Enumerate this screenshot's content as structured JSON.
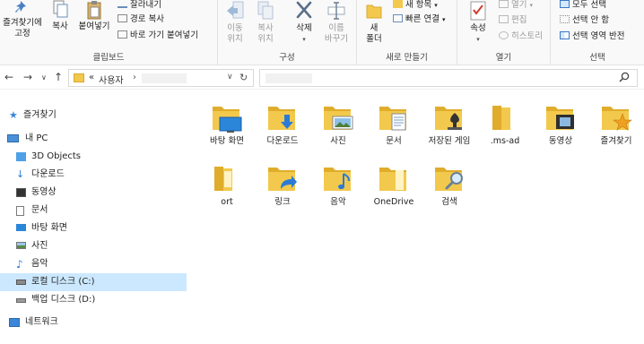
{
  "ribbon": {
    "clipboard": {
      "group_label": "클립보드",
      "pin_label_1": "즐겨찾기에",
      "pin_label_2": "고정",
      "copy_label": "복사",
      "paste_label": "붙여넣기",
      "cut_label": "잘라내기",
      "copy_path_label": "경로 복사",
      "paste_shortcut_label": "바로 가기 붙여넣기"
    },
    "organize": {
      "group_label": "구성",
      "move_label_1": "이동",
      "move_label_2": "위치",
      "copyto_label_1": "복사",
      "copyto_label_2": "위치",
      "delete_label": "삭제",
      "rename_label_1": "이름",
      "rename_label_2": "바꾸기"
    },
    "new": {
      "group_label": "새로 만들기",
      "new_folder_label_1": "새",
      "new_folder_label_2": "폴더",
      "new_item_label": "새 항목",
      "easy_access_label": "빠른 연결"
    },
    "open": {
      "group_label": "열기",
      "properties_label": "속성",
      "open_label": "열기",
      "edit_label": "편집",
      "history_label": "히스토리"
    },
    "select": {
      "group_label": "선택",
      "select_all_label": "모두 선택",
      "select_none_label": "선택 안 함",
      "invert_label": "선택 영역 반전"
    }
  },
  "address": {
    "prefix": "«",
    "segment": "사용자",
    "separator": "›"
  },
  "nav": {
    "quick_access": "즐겨찾기",
    "this_pc": "내 PC",
    "objects3d": "3D Objects",
    "downloads": "다운로드",
    "videos": "동영상",
    "documents": "문서",
    "desktop": "바탕 화면",
    "pictures": "사진",
    "music": "음악",
    "local_disk": "로컬 디스크 (C:)",
    "backup_disk": "백업 디스크 (D:)",
    "network": "네트워크"
  },
  "items": [
    {
      "label": "바탕 화면",
      "icon": "desktop-folder-icon"
    },
    {
      "label": "다운로드",
      "icon": "downloads-folder-icon"
    },
    {
      "label": "사진",
      "icon": "pictures-folder-icon"
    },
    {
      "label": "문서",
      "icon": "documents-folder-icon"
    },
    {
      "label": "저장된 게임",
      "icon": "saved-games-folder-icon"
    },
    {
      "label": ".ms-ad",
      "icon": "folder-icon"
    },
    {
      "label": "동영상",
      "icon": "videos-folder-icon"
    },
    {
      "label": "즐겨찾기",
      "icon": "favorites-folder-icon"
    },
    {
      "label": "ort",
      "icon": "folder-icon"
    },
    {
      "label": "링크",
      "icon": "links-folder-icon"
    },
    {
      "label": "음악",
      "icon": "music-folder-icon"
    },
    {
      "label": "OneDrive",
      "icon": "folder-icon"
    },
    {
      "label": "검색",
      "icon": "searches-folder-icon"
    }
  ],
  "colors": {
    "folder": "#f2c94c",
    "folder_dark": "#e0ac2b",
    "selection": "#cce8ff",
    "accent_blue": "#2b7bd6"
  }
}
